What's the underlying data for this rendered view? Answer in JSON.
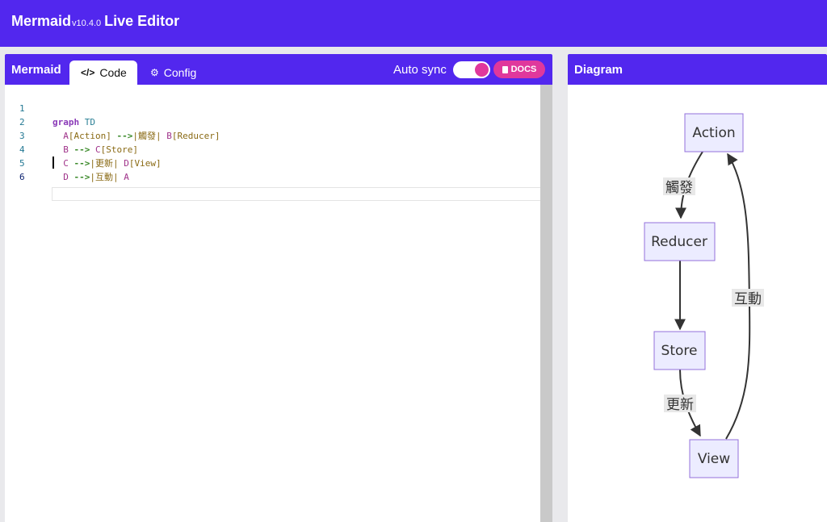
{
  "app": {
    "name": "Mermaid",
    "version": "v10.4.0",
    "suffix": "Live Editor"
  },
  "editor_panel": {
    "title": "Mermaid",
    "tabs": [
      {
        "label": "Code",
        "active": true
      },
      {
        "label": "Config",
        "active": false
      }
    ],
    "auto_sync_label": "Auto sync",
    "auto_sync_on": true,
    "docs_label": "DOCS"
  },
  "code_lines": [
    {
      "n": "1",
      "code": "graph TD"
    },
    {
      "n": "2",
      "code": "  A[Action] -->|觸發| B[Reducer]"
    },
    {
      "n": "3",
      "code": "  B --> C[Store]"
    },
    {
      "n": "4",
      "code": "  C -->|更新| D[View]"
    },
    {
      "n": "5",
      "code": "  D -->|互動| A"
    },
    {
      "n": "6",
      "code": ""
    }
  ],
  "diagram_panel": {
    "title": "Diagram"
  },
  "diagram": {
    "nodes": [
      {
        "id": "A",
        "label": "Action"
      },
      {
        "id": "B",
        "label": "Reducer"
      },
      {
        "id": "C",
        "label": "Store"
      },
      {
        "id": "D",
        "label": "View"
      }
    ],
    "edges": [
      {
        "from": "A",
        "to": "B",
        "label": "觸發"
      },
      {
        "from": "B",
        "to": "C",
        "label": ""
      },
      {
        "from": "C",
        "to": "D",
        "label": "更新"
      },
      {
        "from": "D",
        "to": "A",
        "label": "互動"
      }
    ]
  },
  "colors": {
    "brand": "#5227ee",
    "accent": "#e0389c",
    "node_fill": "#ececff",
    "node_stroke": "#9370db"
  }
}
